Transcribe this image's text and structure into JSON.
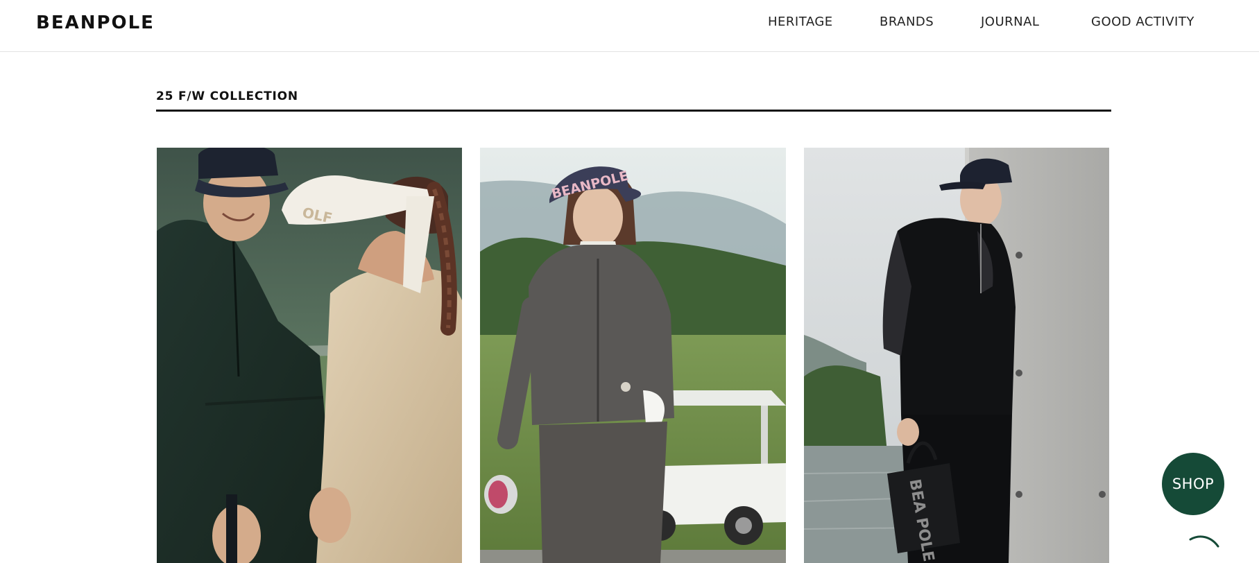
{
  "brand": {
    "logo": "BEANPOLE"
  },
  "nav": [
    {
      "label": "HERITAGE"
    },
    {
      "label": "BRANDS"
    },
    {
      "label": "JOURNAL"
    },
    {
      "label": "GOOD ACTIVITY"
    }
  ],
  "collection": {
    "title": "25 F/W COLLECTION",
    "cards": [
      {
        "image": "couple-golf-windbreaker-visor-photo",
        "logo_visible_text": "OLF"
      },
      {
        "image": "woman-golf-course-knit-zipup-cart-photo",
        "logo_visible_text": "BEANPOLE"
      },
      {
        "image": "man-concrete-wall-black-outfit-bag-photo",
        "logo_visible_text": "BEA POLE"
      }
    ]
  },
  "floating": {
    "shop_label": "SHOP",
    "scroll_icon": "scroll-top-arc-icon"
  },
  "colors": {
    "accent": "#154a37",
    "text": "#111111",
    "divider": "#e2e2e2"
  }
}
